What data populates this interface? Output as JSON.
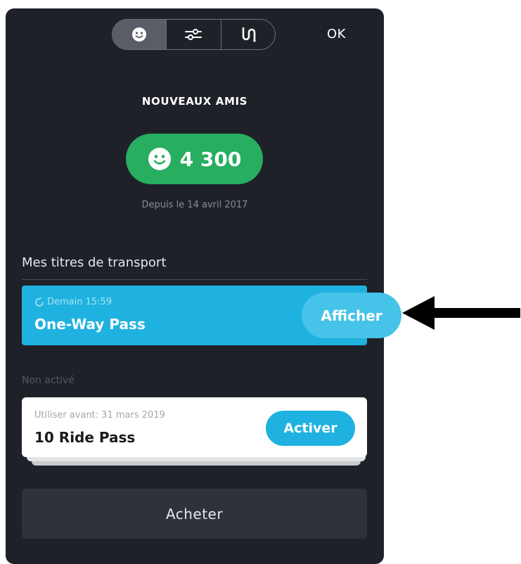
{
  "header": {
    "tabs": [
      {
        "icon": "smiley-icon",
        "active": true
      },
      {
        "icon": "sliders-icon",
        "active": false
      },
      {
        "icon": "route-icon",
        "active": false
      }
    ],
    "ok_label": "OK"
  },
  "friends": {
    "heading": "NOUVEAUX AMIS",
    "count": "4 300",
    "since": "Depuis le 14 avril 2017"
  },
  "tickets": {
    "section_title": "Mes titres de transport",
    "active": {
      "meta": "Demain 15:59",
      "name": "One-Way Pass",
      "action_label": "Afficher"
    },
    "inactive_label": "Non activé",
    "inactive": {
      "meta": "Utiliser avant: 31 mars 2019",
      "name": "10 Ride Pass",
      "action_label": "Activer"
    }
  },
  "buy_label": "Acheter",
  "colors": {
    "panel": "#1f2129",
    "green": "#27ae60",
    "blue": "#1fb2e0",
    "blue_light": "#46c3e8"
  }
}
